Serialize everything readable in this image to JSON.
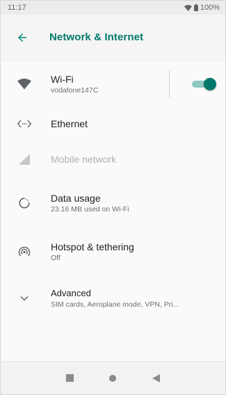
{
  "status_bar": {
    "time": "11:17",
    "battery": "100%"
  },
  "app_bar": {
    "title": "Network & Internet",
    "back_icon": "arrow-back-icon"
  },
  "items": [
    {
      "label": "Wi-Fi",
      "summary": "vodafone147C",
      "icon": "wifi-icon",
      "toggle_on": true,
      "accent": "#00796b"
    },
    {
      "label": "Ethernet",
      "summary": "",
      "icon": "ethernet-icon"
    },
    {
      "label": "Mobile network",
      "summary": "",
      "icon": "cellular-icon",
      "disabled": true
    },
    {
      "label": "Data usage",
      "summary": "23.16 MB used on Wi-Fi",
      "icon": "data-usage-icon"
    },
    {
      "label": "Hotspot & tethering",
      "summary": "Off",
      "icon": "hotspot-icon"
    },
    {
      "label": "Advanced",
      "summary": "SIM cards, Aeroplane mode, VPN, Pri...",
      "icon": "chevron-down-icon"
    }
  ],
  "nav_bar": {
    "buttons": [
      "recents-icon",
      "home-icon",
      "back-triangle-icon"
    ]
  }
}
